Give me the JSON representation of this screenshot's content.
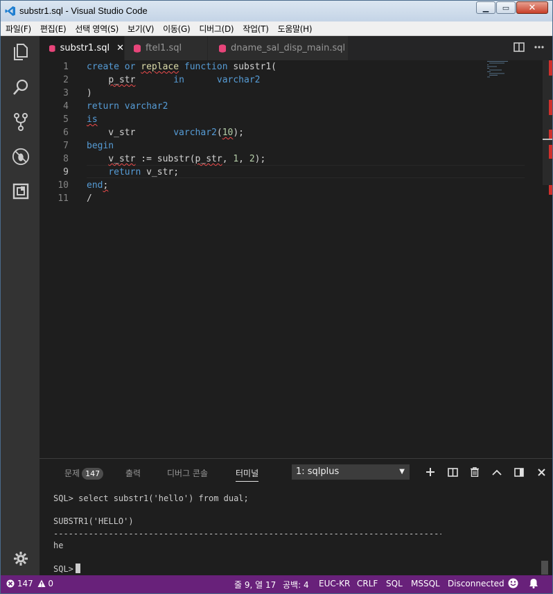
{
  "window": {
    "title": "substr1.sql - Visual Studio Code"
  },
  "menu": [
    "파일(F)",
    "편집(E)",
    "선택 영역(S)",
    "보기(V)",
    "이동(G)",
    "디버그(D)",
    "작업(T)",
    "도움말(H)"
  ],
  "tabs": [
    {
      "label": "substr1.sql",
      "close": "✕"
    },
    {
      "label": "ftel1.sql"
    },
    {
      "label": "dname_sal_disp_main.sql"
    }
  ],
  "editor": {
    "line_numbers": [
      "1",
      "2",
      "3",
      "4",
      "5",
      "6",
      "7",
      "8",
      "9",
      "10",
      "11"
    ],
    "current_line": 9
  },
  "panel": {
    "tabs": {
      "problems": "문제",
      "problems_count": "147",
      "output": "출력",
      "debug": "디버그 콘솔",
      "terminal": "터미널"
    },
    "terminal_select": "1: sqlplus",
    "lines": [
      "SQL> select substr1('hello') from dual;",
      "SUBSTR1('HELLO')",
      "--------------------------------------------------------------------------------",
      "he",
      "SQL>"
    ]
  },
  "status": {
    "errors": "147",
    "warnings": "0",
    "position": "줄 9, 열 17",
    "spaces": "공백: 4",
    "encoding": "EUC-KR",
    "eol": "CRLF",
    "language": "SQL",
    "connection_type": "MSSQL",
    "connection": "Disconnected"
  },
  "colors": {
    "statusbar": "#68217a",
    "activitybar": "#333333",
    "editor": "#1e1e1e",
    "keyword": "#569cd6"
  }
}
